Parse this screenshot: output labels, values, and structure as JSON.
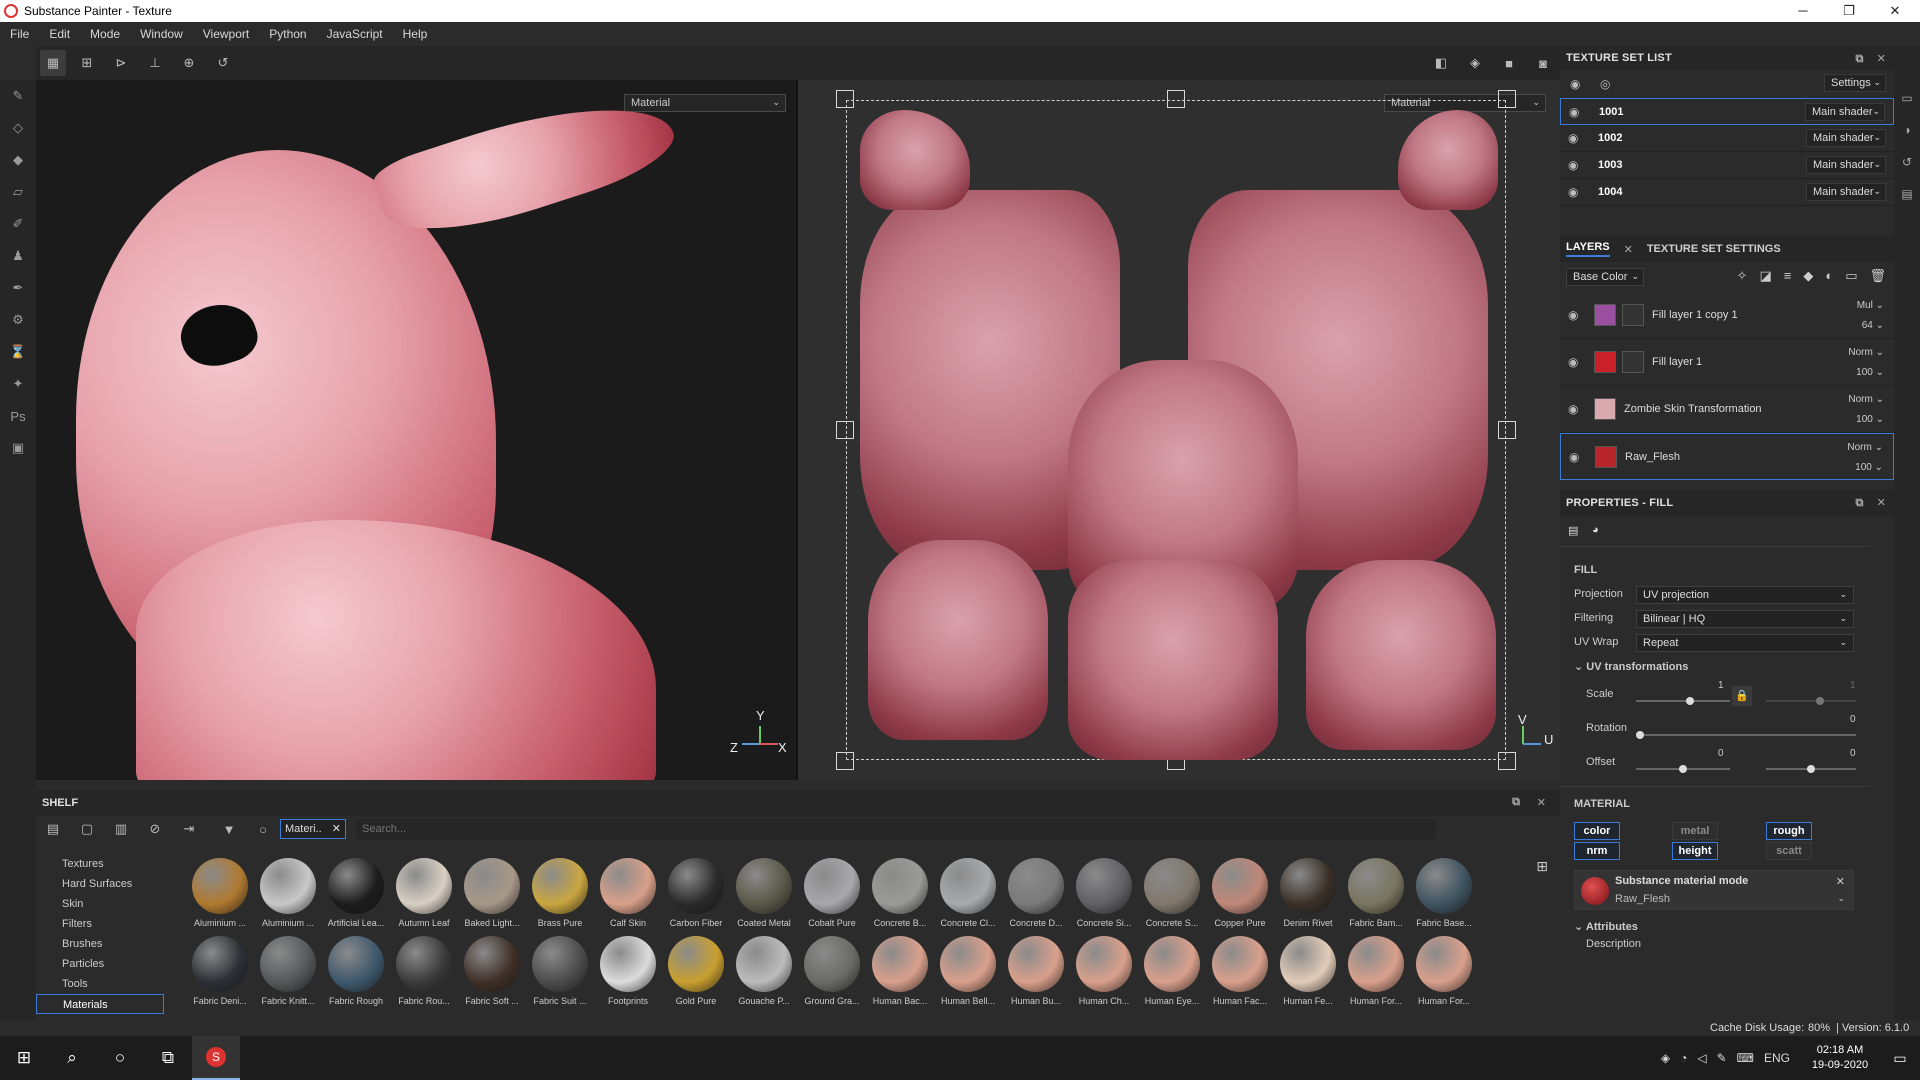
{
  "window": {
    "title": "Substance Painter - Texture",
    "minimize": "─",
    "maximize": "❐",
    "close": "✕"
  },
  "menu": [
    "File",
    "Edit",
    "Mode",
    "Window",
    "Viewport",
    "Python",
    "JavaScript",
    "Help"
  ],
  "viewport3d": {
    "channel_select": "Material",
    "axes": {
      "x": "X",
      "y": "Y",
      "z": "Z"
    }
  },
  "viewport2d": {
    "channel_select": "Material",
    "axes": {
      "v": "V",
      "u": "U"
    }
  },
  "texture_set_list": {
    "title": "TEXTURE SET LIST",
    "settings_label": "Settings",
    "sets": [
      {
        "name": "1001",
        "shader": "Main shader"
      },
      {
        "name": "1002",
        "shader": "Main shader"
      },
      {
        "name": "1003",
        "shader": "Main shader"
      },
      {
        "name": "1004",
        "shader": "Main shader"
      }
    ]
  },
  "layers_panel": {
    "tabs": [
      "LAYERS",
      "TEXTURE SET SETTINGS"
    ],
    "channel": "Base Color",
    "layers": [
      {
        "name": "Fill layer 1 copy 1",
        "blend": "Mul",
        "opacity": "64",
        "color": "#9b4fa0"
      },
      {
        "name": "Fill layer 1",
        "blend": "Norm",
        "opacity": "100",
        "color": "#c9202a"
      },
      {
        "name": "Zombie Skin Transformation",
        "blend": "Norm",
        "opacity": "100",
        "color": "#d8aaae"
      },
      {
        "name": "Raw_Flesh",
        "blend": "Norm",
        "opacity": "100",
        "color": "#b8262c"
      }
    ]
  },
  "properties": {
    "title": "PROPERTIES - FILL",
    "section": "FILL",
    "projection_label": "Projection",
    "projection": "UV projection",
    "filtering_label": "Filtering",
    "filtering": "Bilinear | HQ",
    "uvwrap_label": "UV Wrap",
    "uvwrap": "Repeat",
    "uv_transform_label": "UV transformations",
    "scale_label": "Scale",
    "scale_value": "1",
    "scale_value2": "1",
    "rotation_label": "Rotation",
    "rotation_value": "0",
    "offset_label": "Offset",
    "offset_value1": "0",
    "offset_value2": "0",
    "material_section": "MATERIAL",
    "chips": [
      {
        "label": "color",
        "on": true
      },
      {
        "label": "metal",
        "on": false
      },
      {
        "label": "rough",
        "on": true
      },
      {
        "label": "nrm",
        "on": true
      },
      {
        "label": "height",
        "on": true
      },
      {
        "label": "scatt",
        "on": false
      }
    ],
    "material_mode_label": "Substance material mode",
    "material_mode_value": "Raw_Flesh",
    "attributes_label": "Attributes",
    "description_label": "Description"
  },
  "shelf": {
    "title": "SHELF",
    "filter_tag": "Materi..",
    "search_placeholder": "Search...",
    "categories": [
      "Textures",
      "Hard Surfaces",
      "Skin",
      "Filters",
      "Brushes",
      "Particles",
      "Tools",
      "Materials"
    ],
    "materials_row1": [
      {
        "label": "Aluminium ...",
        "color": "#b07a30"
      },
      {
        "label": "Aluminium ...",
        "color": "#c8c8c8"
      },
      {
        "label": "Artificial Lea...",
        "color": "#1d1d1d"
      },
      {
        "label": "Autumn Leaf",
        "color": "#d8cfc4"
      },
      {
        "label": "Baked Light...",
        "color": "#a89888"
      },
      {
        "label": "Brass Pure",
        "color": "#c9a640"
      },
      {
        "label": "Calf Skin",
        "color": "#d9a08a"
      },
      {
        "label": "Carbon Fiber",
        "color": "#2a2a2a"
      },
      {
        "label": "Coated Metal",
        "color": "#5a5848"
      },
      {
        "label": "Cobalt Pure",
        "color": "#a8a8ac"
      },
      {
        "label": "Concrete B...",
        "color": "#9a9a96"
      },
      {
        "label": "Concrete Cl...",
        "color": "#a8aaac"
      },
      {
        "label": "Concrete D...",
        "color": "#7a7a7a"
      },
      {
        "label": "Concrete Si...",
        "color": "#606064"
      },
      {
        "label": "Concrete S...",
        "color": "#80786c"
      },
      {
        "label": "Copper Pure",
        "color": "#c08878"
      },
      {
        "label": "Denim Rivet",
        "color": "#3a3028"
      },
      {
        "label": "Fabric Bam...",
        "color": "#7a7560"
      },
      {
        "label": "Fabric Base...",
        "color": "#3e5360"
      }
    ],
    "materials_row2": [
      {
        "label": "Fabric Deni...",
        "color": "#2c3036"
      },
      {
        "label": "Fabric Knitt...",
        "color": "#55585a"
      },
      {
        "label": "Fabric Rough",
        "color": "#3e586c"
      },
      {
        "label": "Fabric Rou...",
        "color": "#3a3a3a"
      },
      {
        "label": "Fabric Soft ...",
        "color": "#403028"
      },
      {
        "label": "Fabric Suit ...",
        "color": "#4c4c4c"
      },
      {
        "label": "Footprints",
        "color": "#dcdcdc"
      },
      {
        "label": "Gold Pure",
        "color": "#c9a030"
      },
      {
        "label": "Gouache P...",
        "color": "#bcbcbc"
      },
      {
        "label": "Ground Gra...",
        "color": "#6a6a68"
      },
      {
        "label": "Human Bac...",
        "color": "#d9a08c"
      },
      {
        "label": "Human Bell...",
        "color": "#d9a08c"
      },
      {
        "label": "Human Bu...",
        "color": "#d9a08c"
      },
      {
        "label": "Human Ch...",
        "color": "#d9a08c"
      },
      {
        "label": "Human Eye...",
        "color": "#d9a08c"
      },
      {
        "label": "Human Fac...",
        "color": "#d9a08c"
      },
      {
        "label": "Human Fe...",
        "color": "#e2cbb8"
      },
      {
        "label": "Human For...",
        "color": "#d9a08c"
      },
      {
        "label": "Human For...",
        "color": "#d9a08c"
      }
    ]
  },
  "status": {
    "cache": "Cache Disk Usage:",
    "percent": "80%",
    "version": "| Version: 6.1.0"
  },
  "taskbar": {
    "lang": "ENG",
    "time": "02:18 AM",
    "date": "19-09-2020"
  }
}
